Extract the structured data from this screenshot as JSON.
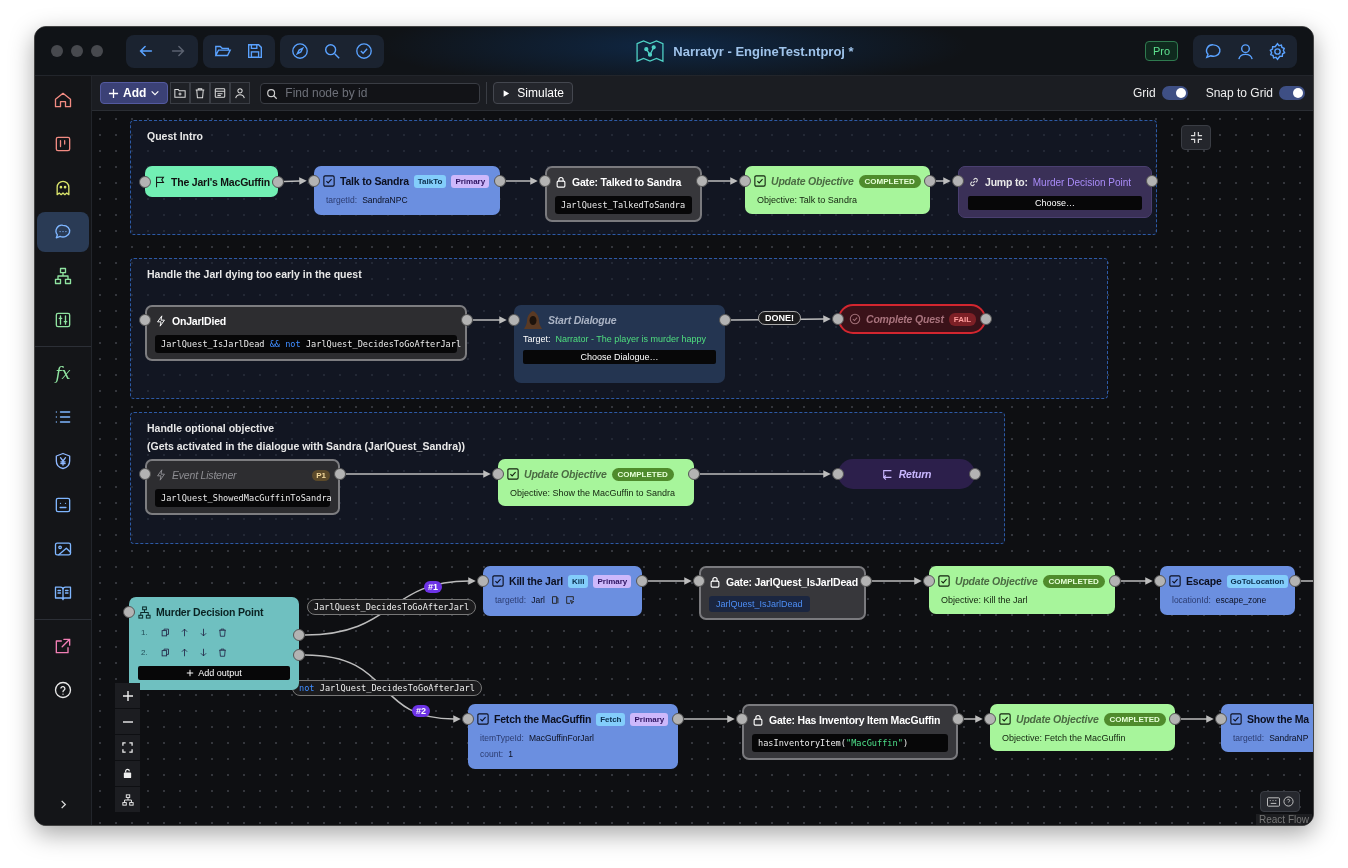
{
  "window": {
    "title": "Narratyr - EngineTest.ntproj *",
    "plan_badge": "Pro"
  },
  "sidebar": {
    "sections": [
      {
        "items": [
          {
            "kind": "home",
            "selected": false
          },
          {
            "kind": "board",
            "selected": false
          },
          {
            "kind": "ghost",
            "selected": false
          },
          {
            "kind": "chat",
            "selected": true
          },
          {
            "kind": "hierarchy",
            "selected": false
          },
          {
            "kind": "sliders",
            "selected": false
          }
        ]
      },
      {
        "items": [
          {
            "kind": "text",
            "label": "fx",
            "selected": false
          },
          {
            "kind": "list",
            "selected": false
          },
          {
            "kind": "shield",
            "selected": false
          },
          {
            "kind": "face",
            "selected": false
          },
          {
            "kind": "image",
            "selected": false
          },
          {
            "kind": "book",
            "selected": false
          }
        ]
      },
      {
        "items": [
          {
            "kind": "export",
            "selected": false
          },
          {
            "kind": "help",
            "selected": false
          }
        ]
      }
    ]
  },
  "toolbar": {
    "add_button": "Add",
    "search": {
      "placeholder": "Find node by id"
    },
    "simulate_button": "Simulate",
    "toggles": [
      {
        "label": "Grid",
        "on": true
      },
      {
        "label": "Snap to Grid",
        "on": true
      }
    ]
  },
  "canvas": {
    "groups": [
      {
        "title": "Quest Intro"
      },
      {
        "title": "Handle the Jarl dying too early in the quest"
      },
      {
        "title": "Handle optional objective",
        "subtitle": "(Gets activated in the dialogue with Sandra (JarlQuest_Sandra))"
      }
    ],
    "nodes": [
      {
        "kind": "start",
        "title": "The Jarl's MacGuffin"
      },
      {
        "kind": "task",
        "title": "Talk to Sandra",
        "badges": [
          {
            "kind": "type",
            "text": "TalkTo"
          },
          {
            "kind": "priority",
            "text": "Primary"
          }
        ],
        "fields": [
          {
            "key": "targetId:",
            "value": "SandraNPC"
          }
        ]
      },
      {
        "kind": "gate",
        "title": "Gate: Talked to Sandra",
        "condition": [
          {
            "kind": "ident",
            "text": "JarlQuest_TalkedToSandra"
          }
        ]
      },
      {
        "kind": "objective",
        "title": "Update Objective",
        "status": "COMPLETED",
        "text": "Objective: Talk to Sandra"
      },
      {
        "kind": "jump",
        "label": "Jump to:",
        "target": "Murder Decision Point",
        "button": "Choose…"
      },
      {
        "kind": "event",
        "title": "OnJarlDied",
        "disabled": false,
        "condition": [
          {
            "kind": "ident",
            "text": "JarlQuest_IsJarlDead "
          },
          {
            "kind": "keyword",
            "text": "&&"
          },
          {
            "kind": "keyword",
            "text": " not"
          },
          {
            "kind": "ident",
            "text": " JarlQuest_DecidesToGoAfterJarl"
          }
        ]
      },
      {
        "kind": "dialogue",
        "title": "Start Dialogue",
        "target_label": "Target:",
        "target": "Narrator - The player is murder happy",
        "button": "Choose Dialogue…"
      },
      {
        "kind": "complete",
        "title": "Complete Quest",
        "result": "FAIL"
      },
      {
        "kind": "event",
        "title": "Event Listener",
        "disabled": true,
        "badge": "P1",
        "condition": [
          {
            "kind": "ident",
            "text": "JarlQuest_ShowedMacGuffinToSandra"
          }
        ]
      },
      {
        "kind": "objective",
        "title": "Update Objective",
        "status": "COMPLETED",
        "text": "Objective: Show the MacGuffin to Sandra"
      },
      {
        "kind": "return",
        "title": "Return"
      },
      {
        "kind": "decision",
        "title": "Murder Decision Point",
        "outputs": [
          {
            "number": "1."
          },
          {
            "number": "2."
          }
        ],
        "button": "Add output"
      },
      {
        "kind": "task",
        "title": "Kill the Jarl",
        "badges": [
          {
            "kind": "type",
            "text": "Kill"
          },
          {
            "kind": "priority",
            "text": "Primary"
          }
        ],
        "fields": [
          {
            "key": "targetId:",
            "value": "Jarl"
          }
        ],
        "tools": true
      },
      {
        "kind": "gate",
        "title": "Gate: JarlQuest_IsJarlDead",
        "condition": [
          {
            "kind": "variable",
            "text": "JarlQuest_IsJarlDead"
          }
        ]
      },
      {
        "kind": "objective",
        "title": "Update Objective",
        "status": "COMPLETED",
        "text": "Objective: Kill the Jarl"
      },
      {
        "kind": "task",
        "title": "Escape",
        "badges": [
          {
            "kind": "type",
            "text": "GoToLocation"
          }
        ],
        "fields": [
          {
            "key": "locationId:",
            "value": "escape_zone"
          }
        ]
      },
      {
        "kind": "task",
        "title": "Fetch the MacGuffin",
        "badges": [
          {
            "kind": "type",
            "text": "Fetch"
          },
          {
            "kind": "priority",
            "text": "Primary"
          }
        ],
        "fields": [
          {
            "key": "itemTypeId:",
            "value": "MacGuffinForJarl"
          },
          {
            "key": "count:",
            "value": "1"
          }
        ]
      },
      {
        "kind": "gate",
        "title": "Gate: Has Inventory Item MacGuffin",
        "condition": [
          {
            "kind": "ident",
            "text": "hasInventoryItem("
          },
          {
            "kind": "string",
            "text": "\"MacGuffin\""
          },
          {
            "kind": "ident",
            "text": ")"
          }
        ]
      },
      {
        "kind": "objective",
        "title": "Update Objective",
        "status": "COMPLETED",
        "text": "Objective: Fetch the MacGuffin"
      },
      {
        "kind": "task",
        "title": "Show the Ma",
        "fields": [
          {
            "key": "targetId:",
            "value": "SandraNP"
          }
        ]
      }
    ],
    "edge_labels": [
      {
        "kind": "plain",
        "text": "DONE!"
      },
      {
        "kind": "index",
        "text": "#1"
      },
      {
        "kind": "condition",
        "condition": [
          {
            "kind": "ident",
            "text": "JarlQuest_DecidesToGoAfterJarl"
          }
        ]
      },
      {
        "kind": "condition",
        "condition": [
          {
            "kind": "keyword",
            "text": "not"
          },
          {
            "kind": "ident",
            "text": " JarlQuest_DecidesToGoAfterJarl"
          }
        ]
      },
      {
        "kind": "index",
        "text": "#2"
      }
    ],
    "attribution": "React Flow"
  }
}
